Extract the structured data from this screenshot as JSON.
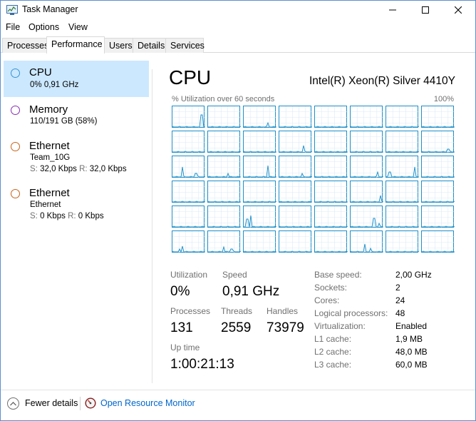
{
  "window": {
    "title": "Task Manager"
  },
  "menu": [
    "File",
    "Options",
    "View"
  ],
  "tabs": [
    "Processes",
    "Performance",
    "Users",
    "Details",
    "Services"
  ],
  "active_tab": "Performance",
  "sidebar": {
    "items": [
      {
        "title": "CPU",
        "line1": "0% 0,91 GHz",
        "color": "#3794d1",
        "selected": true
      },
      {
        "title": "Memory",
        "line1": "110/191 GB (58%)",
        "color": "#8a2cb3"
      },
      {
        "title": "Ethernet",
        "line1": "Team_10G",
        "send_label": "S:",
        "send": "32,0 Kbps",
        "recv_label": "R:",
        "recv": "32,0 Kbps",
        "color": "#c8641c"
      },
      {
        "title": "Ethernet",
        "line1": "Ethernet",
        "send_label": "S:",
        "send": "0 Kbps",
        "recv_label": "R:",
        "recv": "0 Kbps",
        "color": "#c8641c"
      }
    ]
  },
  "main": {
    "title": "CPU",
    "model": "Intel(R) Xeon(R) Silver 4410Y",
    "graph_label": "% Utilization over 60 seconds",
    "graph_max": "100%",
    "graph_color": "#1d8fc9",
    "stats": {
      "utilization_label": "Utilization",
      "utilization": "0%",
      "speed_label": "Speed",
      "speed": "0,91 GHz",
      "processes_label": "Processes",
      "processes": "131",
      "threads_label": "Threads",
      "threads": "2559",
      "handles_label": "Handles",
      "handles": "73979",
      "uptime_label": "Up time",
      "uptime": "1:00:21:13"
    },
    "specs": [
      {
        "label": "Base speed:",
        "value": "2,00 GHz"
      },
      {
        "label": "Sockets:",
        "value": "2"
      },
      {
        "label": "Cores:",
        "value": "24"
      },
      {
        "label": "Logical processors:",
        "value": "48"
      },
      {
        "label": "Virtualization:",
        "value": "Enabled"
      },
      {
        "label": "L1 cache:",
        "value": "1,9 MB"
      },
      {
        "label": "L2 cache:",
        "value": "48,0 MB"
      },
      {
        "label": "L3 cache:",
        "value": "60,0 MB"
      }
    ]
  },
  "footer": {
    "fewer_details": "Fewer details",
    "resource_monitor": "Open Resource Monitor"
  },
  "icons": {
    "app": "task-manager-icon",
    "minimize": "minimize-icon",
    "maximize": "maximize-icon",
    "close": "close-icon",
    "fewer": "chevron-up-icon",
    "resource_monitor": "resource-monitor-icon"
  }
}
